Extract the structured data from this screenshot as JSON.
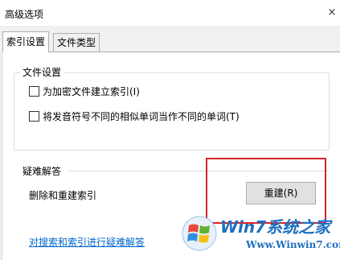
{
  "window": {
    "title": "高级选项",
    "close_glyph": "×"
  },
  "tabs": [
    {
      "label": "索引设置",
      "active": true
    },
    {
      "label": "文件类型",
      "active": false
    }
  ],
  "file_settings": {
    "title": "文件设置",
    "options": [
      {
        "label": "为加密文件建立索引(I)",
        "checked": false
      },
      {
        "label": "将发音符号不同的相似单词当作不同的单词(T)",
        "checked": false
      }
    ]
  },
  "troubleshoot": {
    "title": "疑难解答",
    "rebuild_text": "删除和重建索引",
    "rebuild_button": "重建(R)",
    "link": "对搜索和索引进行疑难解答"
  },
  "watermark": {
    "brand": "Win7系统之家",
    "url": "Www.Winwin7.com"
  },
  "colors": {
    "highlight_box": "#d9232b",
    "link": "#0066cc",
    "watermark_blue": "#1d6fc0"
  }
}
